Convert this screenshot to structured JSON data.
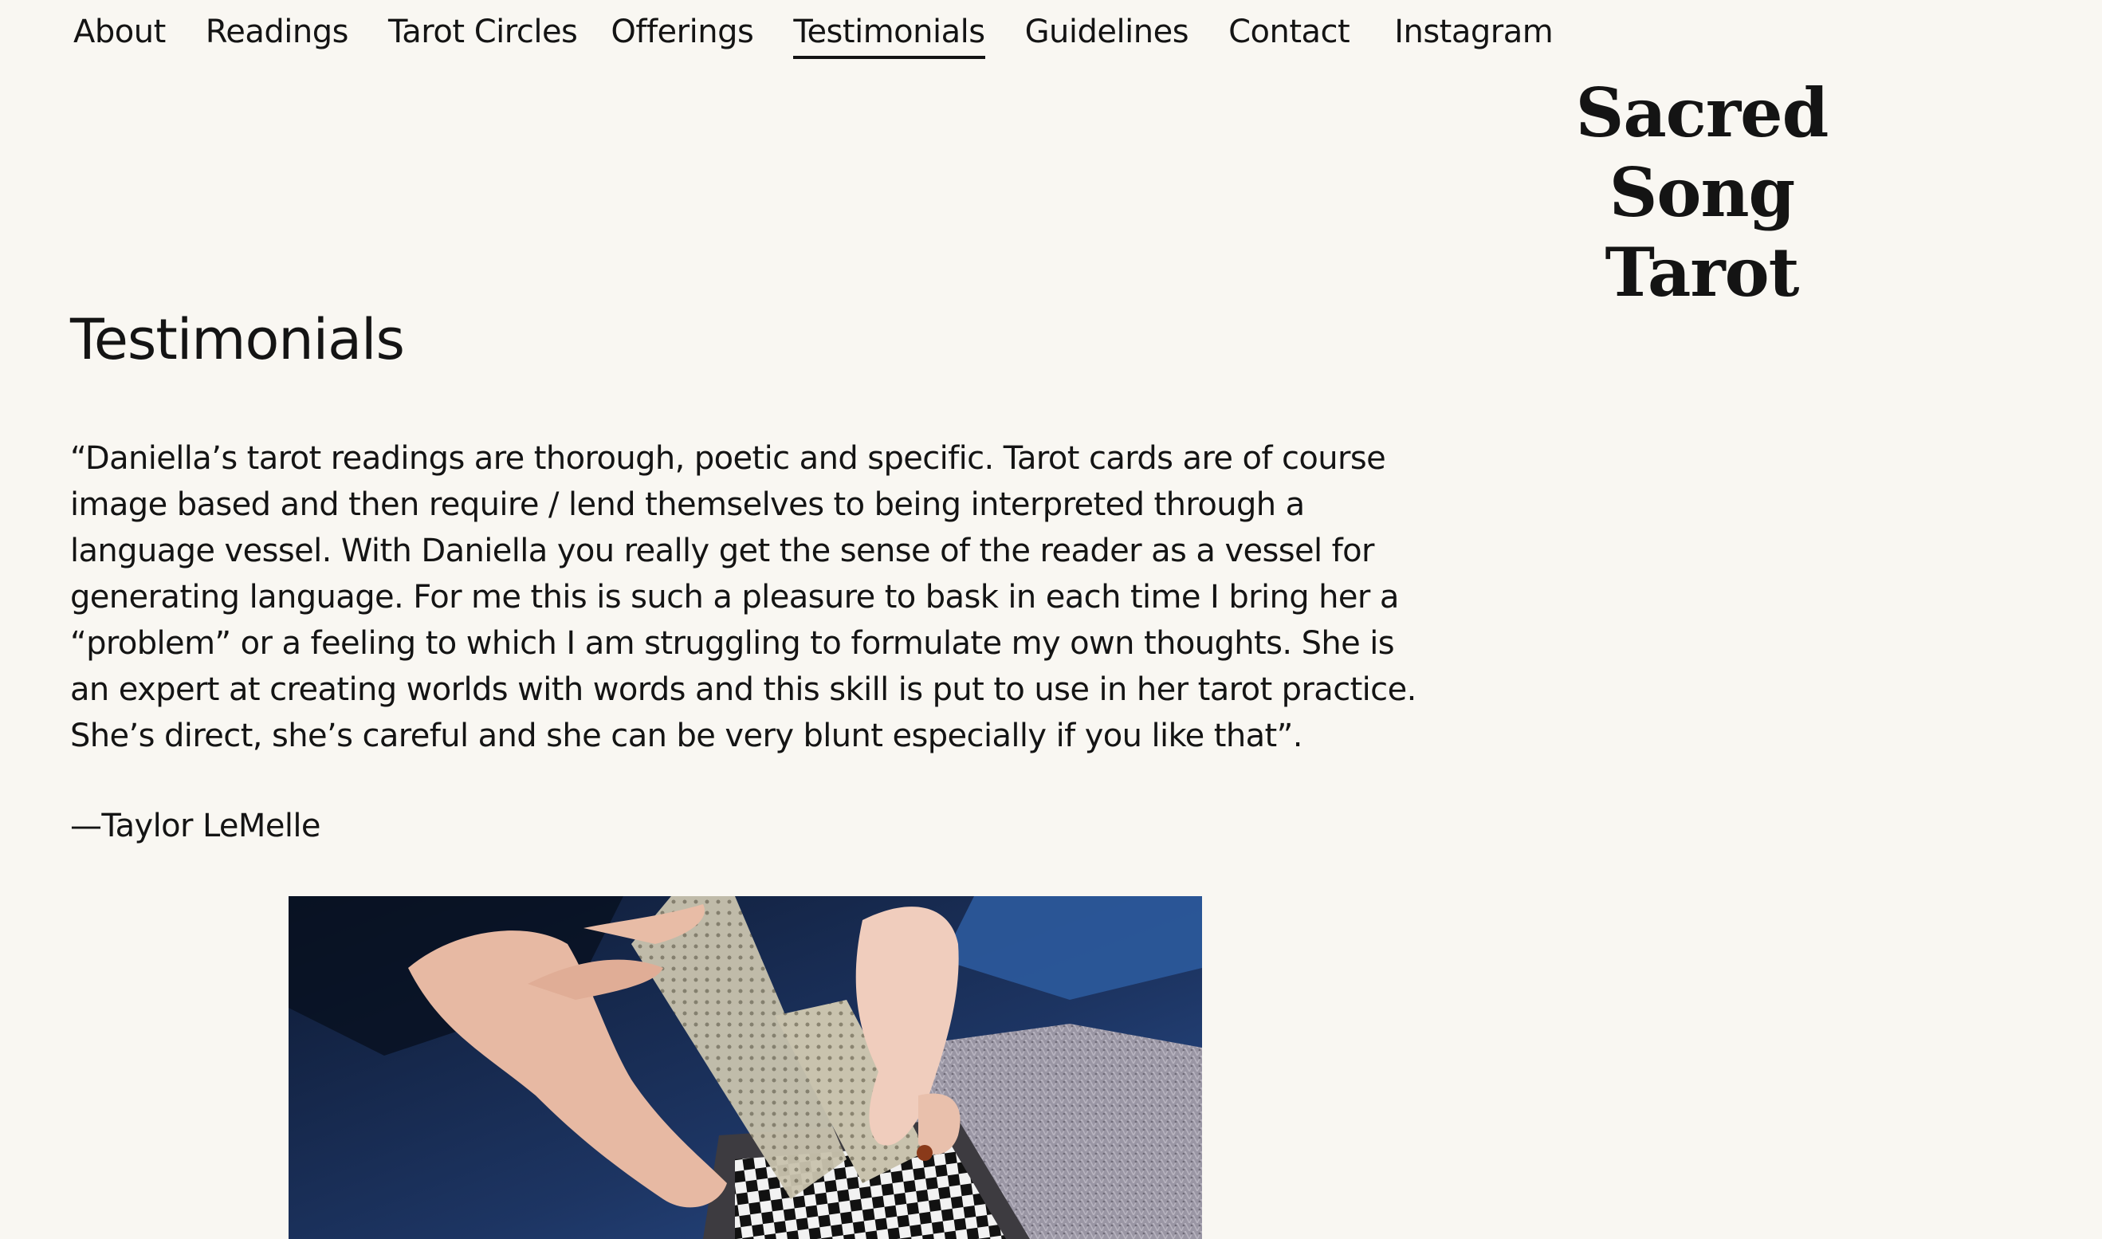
{
  "nav": {
    "items": [
      {
        "label": "About"
      },
      {
        "label": "Readings"
      },
      {
        "label": "Tarot Circles"
      },
      {
        "label": "Offerings"
      },
      {
        "label": "Testimonials",
        "active": true
      },
      {
        "label": "Guidelines"
      },
      {
        "label": "Contact"
      },
      {
        "label": "Instagram"
      }
    ]
  },
  "brand": {
    "line1": "Sacred Song",
    "line2": "Tarot"
  },
  "page": {
    "title": "Testimonials"
  },
  "testimonial": {
    "quote": "“Daniella’s tarot readings are thorough, poetic and specific. Tarot cards are of course image based and then require / lend themselves to being interpreted through a language vessel. With Daniella you really get the sense of the reader as a vessel for generating language. For me this is such a pleasure to bask in each time I bring her a “problem” or a feeling to which I am struggling to formulate my own thoughts. She is an expert at creating worlds with words and this skill is put to use in her tarot practice. She’s direct, she’s careful and she can be very blunt especially if you like that”.",
    "author": "—Taylor LeMelle"
  },
  "colors": {
    "background": "#f9f7f2",
    "text": "#141414",
    "denim": "#1b2a4a",
    "rug": "#9a96a4"
  }
}
